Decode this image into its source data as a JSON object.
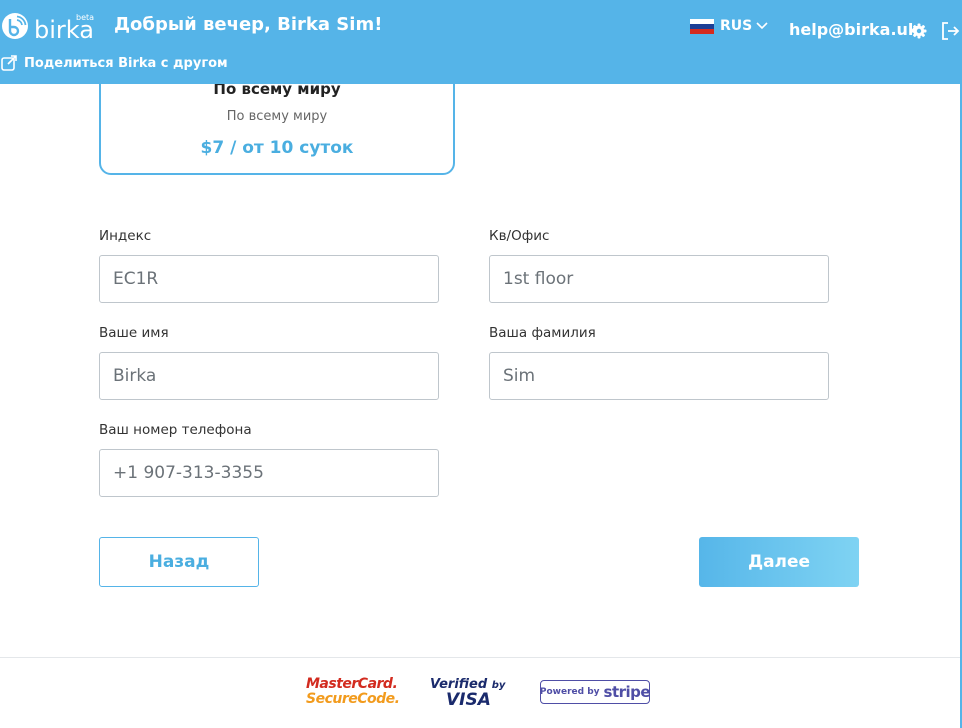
{
  "header": {
    "logo_text": "birka",
    "logo_badge": "beta",
    "greeting": "Добрый вечер, Birka Sim!",
    "share_label": "Поделиться Birka с другом",
    "language": "RUS",
    "email": "help@birka.uk",
    "icons": [
      "share-icon",
      "chevron-down-icon",
      "gear-icon",
      "logout-icon"
    ]
  },
  "plan": {
    "title": "По всему миру",
    "subtitle": "По всему миру",
    "price": "$7 / от 10 суток"
  },
  "form": {
    "postcode_label": "Индекс",
    "postcode_value": "EC1R",
    "apartment_label": "Кв/Офис",
    "apartment_value": "1st floor",
    "first_name_label": "Ваше имя",
    "first_name_value": "Birka",
    "last_name_label": "Ваша фамилия",
    "last_name_value": "Sim",
    "phone_label": "Ваш номер телефона",
    "phone_value": "+1 907-313-3355"
  },
  "actions": {
    "back_label": "Назад",
    "next_label": "Далее"
  },
  "footer": {
    "mastercard_line1": "MasterCard.",
    "mastercard_line2": "SecureCode.",
    "visa_line1": "Verified",
    "visa_by": "by",
    "visa_line2": "VISA",
    "stripe_prefix": "Powered by",
    "stripe_brand": "stripe"
  },
  "colors": {
    "brand": "#55b4e8",
    "accent_text": "#4aaee0"
  }
}
